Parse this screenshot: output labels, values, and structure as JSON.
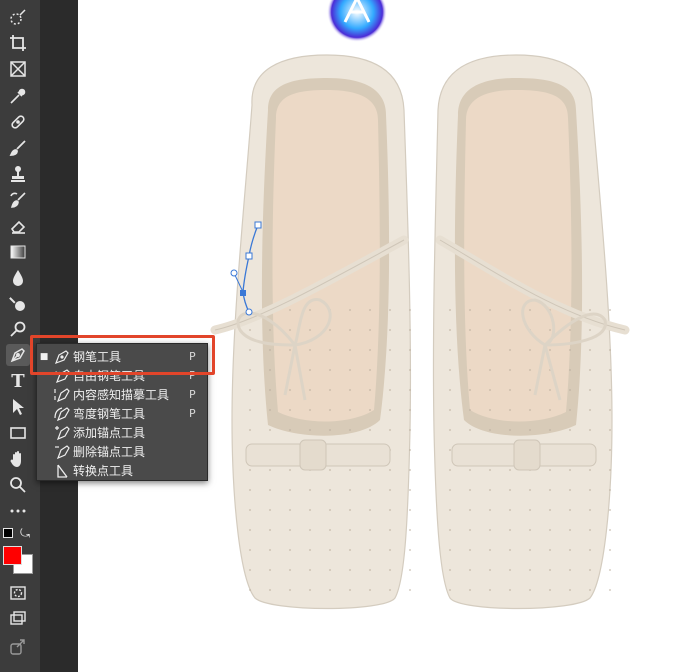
{
  "toolbar": {
    "tools": [
      {
        "name": "quick-selection-icon"
      },
      {
        "name": "crop-icon"
      },
      {
        "name": "frame-icon"
      },
      {
        "name": "eyedropper-icon"
      },
      {
        "name": "healing-brush-icon"
      },
      {
        "name": "brush-icon"
      },
      {
        "name": "clone-stamp-icon"
      },
      {
        "name": "history-brush-icon"
      },
      {
        "name": "eraser-icon"
      },
      {
        "name": "gradient-icon"
      },
      {
        "name": "blur-icon"
      },
      {
        "name": "dodge-icon"
      },
      {
        "name": "sponge-icon"
      },
      {
        "name": "pen-icon"
      },
      {
        "name": "type-icon"
      },
      {
        "name": "path-selection-icon"
      },
      {
        "name": "rectangle-icon"
      },
      {
        "name": "hand-icon"
      },
      {
        "name": "zoom-icon"
      },
      {
        "name": "more-tools-icon"
      }
    ],
    "type_label": "T",
    "foreground_color": "#ff0000",
    "background_color": "#ffffff"
  },
  "flyout": {
    "items": [
      {
        "label": "钢笔工具",
        "key": "P",
        "selected": true,
        "icon": "pen-icon"
      },
      {
        "label": "自由钢笔工具",
        "key": "P",
        "selected": false,
        "icon": "freeform-pen-icon"
      },
      {
        "label": "内容感知描摹工具",
        "key": "P",
        "selected": false,
        "icon": "content-aware-tracing-icon"
      },
      {
        "label": "弯度钢笔工具",
        "key": "P",
        "selected": false,
        "icon": "curvature-pen-icon"
      },
      {
        "label": "添加锚点工具",
        "key": "",
        "selected": false,
        "icon": "add-anchor-icon"
      },
      {
        "label": "删除锚点工具",
        "key": "",
        "selected": false,
        "icon": "delete-anchor-icon"
      },
      {
        "label": "转换点工具",
        "key": "",
        "selected": false,
        "icon": "convert-point-icon"
      }
    ],
    "selected_marker": "■"
  },
  "colors": {
    "highlight": "#e2452a",
    "toolbar": "#3c3c3c",
    "shoe": "#ece5da",
    "insole": "#ecd8c5"
  }
}
